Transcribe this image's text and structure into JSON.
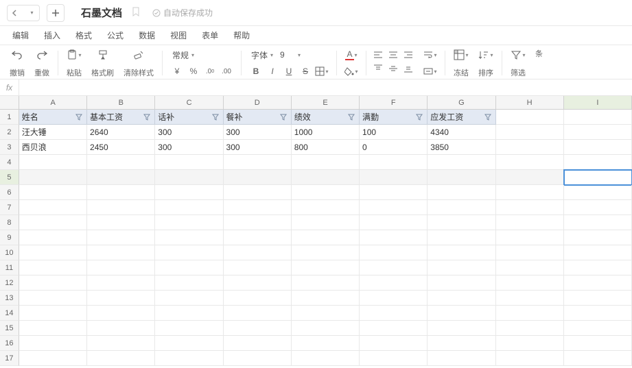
{
  "header": {
    "title": "石墨文档",
    "save_status": "自动保存成功"
  },
  "menu": [
    "编辑",
    "插入",
    "格式",
    "公式",
    "数据",
    "视图",
    "表单",
    "帮助"
  ],
  "toolbar": {
    "undo": "撤销",
    "redo": "重做",
    "paste": "粘贴",
    "format_painter": "格式刷",
    "clear_format": "清除样式",
    "normal": "常规",
    "currency": "¥",
    "percent": "%",
    "dec_inc": ".0",
    "dec_dec": ".00",
    "font": "字体",
    "font_size": "9",
    "bold": "B",
    "italic": "I",
    "underline": "U",
    "strike": "S",
    "freeze": "冻结",
    "sort": "排序",
    "filter": "筛选",
    "conditional": "条"
  },
  "fx": "fx",
  "columns": [
    "A",
    "B",
    "C",
    "D",
    "E",
    "F",
    "G",
    "H",
    "I"
  ],
  "row_numbers": [
    1,
    2,
    3,
    4,
    5,
    6,
    7,
    8,
    9,
    10,
    11,
    12,
    13,
    14,
    15,
    16,
    17
  ],
  "table": {
    "headers": [
      "姓名",
      "基本工资",
      "话补",
      "餐补",
      "绩效",
      "满勤",
      "应发工资"
    ],
    "rows": [
      [
        "汪大锤",
        "2640",
        "300",
        "300",
        "1000",
        "100",
        "4340"
      ],
      [
        "西贝浪",
        "2450",
        "300",
        "300",
        "800",
        "0",
        "3850"
      ]
    ]
  },
  "selection": {
    "row": 5,
    "col": "I"
  }
}
